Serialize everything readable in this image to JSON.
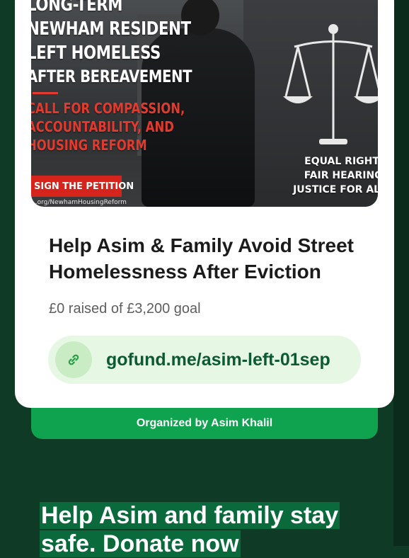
{
  "hero": {
    "headline_lines": [
      "LONG-TERM",
      "NEWHAM RESIDENT",
      "LEFT HOMELESS",
      "AFTER BEREAVEMENT"
    ],
    "subline_lines": [
      "CALL FOR COMPASSION,",
      "ACCOUNTABILITY, AND",
      "HOUSING REFORM"
    ],
    "sign_button": "SIGN THE PETITION",
    "url": "...org/NewhamHousingReform",
    "rights_lines": [
      "EQUAL RIGHTS",
      "FAIR HEARING,",
      "JUSTICE FOR ALL"
    ]
  },
  "fundraiser": {
    "title": "Help Asim & Family Avoid Street Homelessness After Eviction",
    "raised": "£0 raised of £3,200 goal",
    "link": "gofund.me/asim-left-01sep",
    "organizer": "Organized by Asim Khalil"
  },
  "caption": "Help Asim and family stay safe. Donate now",
  "colors": {
    "background": "#0f3a26",
    "accent_green": "#0fa24f",
    "link_text": "#0b5a33",
    "caption_highlight": "#0a6a3b",
    "hero_red": "#e23a2e"
  },
  "icons": {
    "link": "link-icon",
    "scales": "scales-of-justice-icon"
  }
}
